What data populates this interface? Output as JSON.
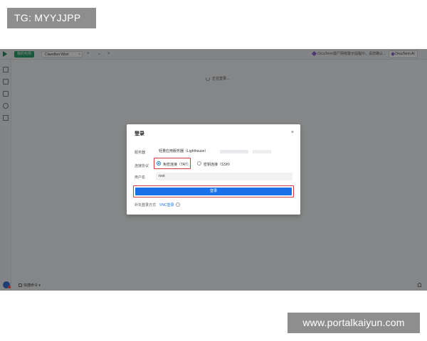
{
  "watermarks": {
    "top_left": "TG: MYYJJPP",
    "bottom_right": "www.portalkaiyun.com"
  },
  "app": {
    "tabs": {
      "active_label": "我的实例",
      "instance_label": "Clawdbot Wbxt"
    },
    "notice_text": "OrcaTerm僵尸网络警示提醒中，请您确认...",
    "orca_button_label": "OrcaTerm AI",
    "loading_text": "正在登录...",
    "shortcut_label": "快捷命令",
    "colors": {
      "accent": "#1b72e8",
      "tab_green": "#27a065",
      "highlight_red": "#d33a3a"
    }
  },
  "dialog": {
    "title": "登录",
    "close_symbol": "×",
    "server_label": "服务器",
    "server_value": "轻量应用服务器（Lighthouse）",
    "protocol_label": "连接协议",
    "protocol_options": [
      {
        "label": "免密连接（TAT）",
        "selected": true
      },
      {
        "label": "密钥连接（SSH）",
        "selected": false
      }
    ],
    "username_label": "用户名",
    "username_value": "root",
    "login_button": "登录",
    "supplementary_label": "补充登录方式",
    "vnc_link": "VNC登录",
    "info_symbol": "i"
  }
}
